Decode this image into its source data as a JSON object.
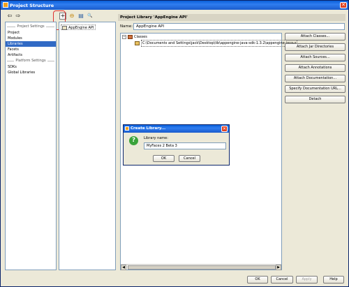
{
  "window": {
    "title": "Project Structure",
    "close_glyph": "✕"
  },
  "toolbar": {
    "left_buttons": [
      {
        "icon": "back-arrow-icon",
        "glyph": "⇦"
      },
      {
        "icon": "forward-arrow-icon",
        "glyph": "⇨"
      }
    ],
    "mid_buttons": [
      {
        "icon": "add-icon",
        "glyph": "+"
      },
      {
        "icon": "remove-icon",
        "glyph": "⊖"
      },
      {
        "icon": "copy-icon",
        "glyph": "▤"
      },
      {
        "icon": "search-icon",
        "glyph": "🔍"
      }
    ]
  },
  "nav": {
    "project_settings_header": "Project Settings",
    "project_items": [
      "Project",
      "Modules",
      "Libraries",
      "Facets",
      "Artifacts"
    ],
    "platform_settings_header": "Platform Settings",
    "platform_items": [
      "SDKs",
      "Global Libraries"
    ],
    "selected": "Libraries"
  },
  "libraries": {
    "items": [
      "AppEngine API"
    ]
  },
  "library_detail": {
    "header": "Project Library 'AppEngine API'",
    "name_label": "Name:",
    "name_value": "AppEngine API",
    "tree": {
      "root_expander": "−",
      "root_label": "Classes",
      "child_label": "C:\\Documents and Settings\\jack\\Desktop\\lib\\appengine-java-sdk-1.3.2\\appengine-java-s"
    },
    "scroll_left": "◀",
    "scroll_right": "▶"
  },
  "side_buttons": [
    "Attach Classes...",
    "Attach Jar Directories",
    "Attach Sources...",
    "Attach Annotations",
    "Attach Documentation...",
    "Specify Documentation URL...",
    "Detach"
  ],
  "dialog": {
    "title": "Create Library...",
    "close_glyph": "✕",
    "question_glyph": "?",
    "label": "Library name:",
    "value": "MyFaces 2 Beta 3",
    "ok": "OK",
    "cancel": "Cancel"
  },
  "footer": {
    "ok": "OK",
    "cancel": "Cancel",
    "apply": "Apply",
    "help": "Help"
  }
}
